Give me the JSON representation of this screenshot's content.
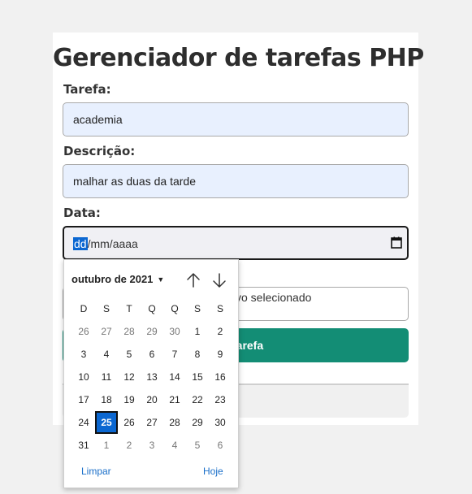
{
  "app": {
    "title": "Gerenciador de tarefas PHP"
  },
  "form": {
    "tarefa_label": "Tarefa:",
    "tarefa_value": "academia",
    "descricao_label": "Descrição:",
    "descricao_value": "malhar as duas da tarde",
    "data_label": "Data:",
    "date_seg_day": "dd",
    "date_seg_sep1": "/",
    "date_seg_month": "mm",
    "date_seg_sep2": "/",
    "date_seg_year": "aaaa",
    "file_status_partial": "vo selecionado",
    "submit_partial": "tarefa"
  },
  "calendar": {
    "month_label": "outubro de 2021",
    "weekdays": [
      "D",
      "S",
      "T",
      "Q",
      "Q",
      "S",
      "S"
    ],
    "weeks": [
      [
        "26",
        "27",
        "28",
        "29",
        "30",
        "1",
        "2"
      ],
      [
        "3",
        "4",
        "5",
        "6",
        "7",
        "8",
        "9"
      ],
      [
        "10",
        "11",
        "12",
        "13",
        "14",
        "15",
        "16"
      ],
      [
        "17",
        "18",
        "19",
        "20",
        "21",
        "22",
        "23"
      ],
      [
        "24",
        "25",
        "26",
        "27",
        "28",
        "29",
        "30"
      ],
      [
        "31",
        "1",
        "2",
        "3",
        "4",
        "5",
        "6"
      ]
    ],
    "selected_day": "25",
    "clear_label": "Limpar",
    "today_label": "Hoje"
  },
  "colors": {
    "accent": "#138d75",
    "selection": "#0b67d1",
    "autofill_bg": "#e8f0fe"
  }
}
